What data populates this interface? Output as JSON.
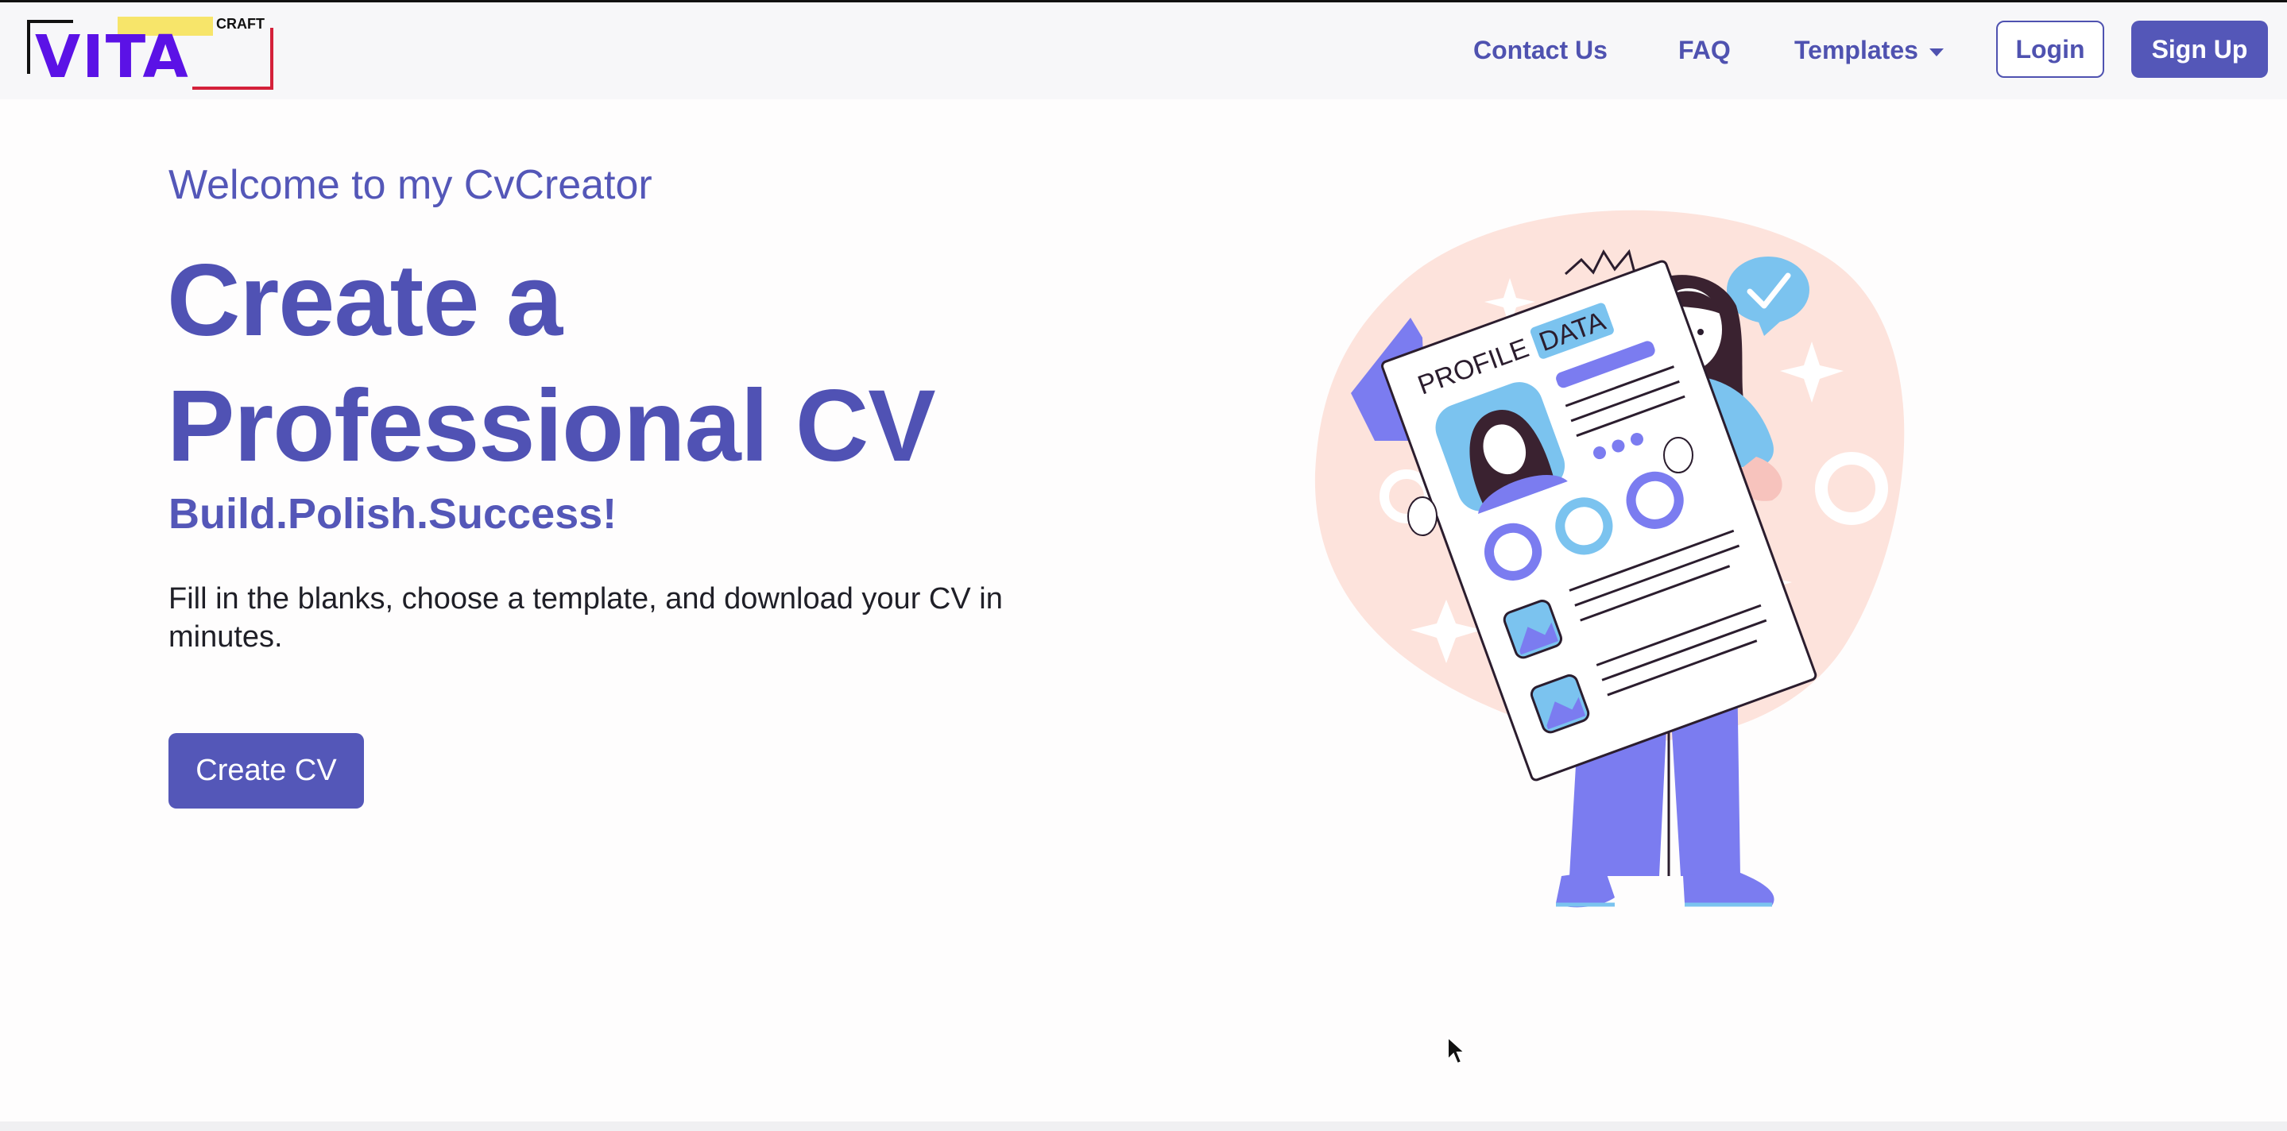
{
  "logo": {
    "main_text": "VITA",
    "small_text": "CRAFT"
  },
  "nav": {
    "contact": "Contact Us",
    "faq": "FAQ",
    "templates": "Templates",
    "login": "Login",
    "signup": "Sign Up"
  },
  "hero": {
    "welcome": "Welcome to my CvCreator",
    "headline_line1": "Create a",
    "headline_line2": "Professional CV",
    "tagline": "Build.Polish.Success!",
    "description": "Fill in the blanks, choose a template, and download your CV in minutes.",
    "cta": "Create CV"
  },
  "illustration": {
    "doc_title_a": "PROFILE",
    "doc_title_b": "DATA"
  },
  "colors": {
    "brand": "#5457b8",
    "blob": "#fde3dc",
    "accent_blue": "#7bc3ef",
    "purple": "#7b7cf0"
  }
}
